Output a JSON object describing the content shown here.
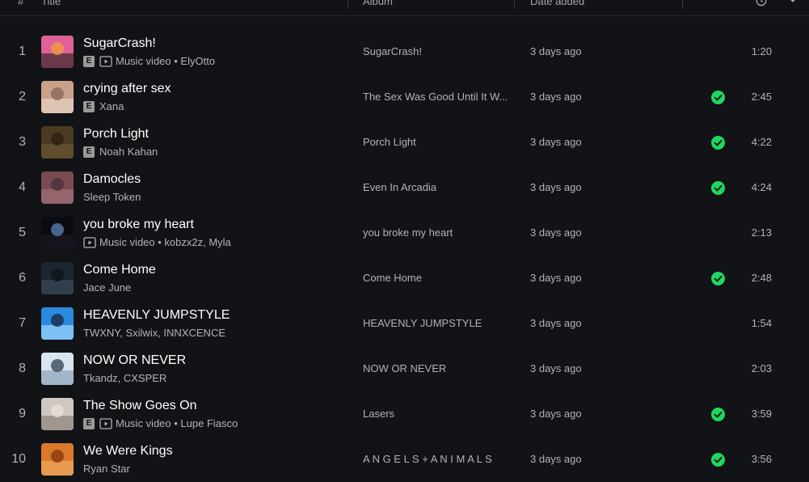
{
  "header": {
    "num": "#",
    "title": "Title",
    "album": "Album",
    "date_added": "Date added",
    "duration_icon": "clock-icon",
    "menu_icon": "chevron-down-icon"
  },
  "colors": {
    "background": "#121316",
    "saved_check": "#1ed760",
    "title_text": "#ffffff",
    "secondary_text": "#b3b3b3"
  },
  "tracks": [
    {
      "num": "1",
      "title": "SugarCrash!",
      "explicit": true,
      "music_video": true,
      "artists": "ElyOtto",
      "album": "SugarCrash!",
      "date": "3 days ago",
      "saved": false,
      "duration": "1:20"
    },
    {
      "num": "2",
      "title": "crying after sex",
      "explicit": true,
      "music_video": false,
      "artists": "Xana",
      "album": "The Sex Was Good Until It W...",
      "date": "3 days ago",
      "saved": true,
      "duration": "2:45"
    },
    {
      "num": "3",
      "title": "Porch Light",
      "explicit": true,
      "music_video": false,
      "artists": "Noah Kahan",
      "album": "Porch Light",
      "date": "3 days ago",
      "saved": true,
      "duration": "4:22"
    },
    {
      "num": "4",
      "title": "Damocles",
      "explicit": false,
      "music_video": false,
      "artists": "Sleep Token",
      "album": "Even In Arcadia",
      "date": "3 days ago",
      "saved": true,
      "duration": "4:24"
    },
    {
      "num": "5",
      "title": "you broke my heart",
      "explicit": false,
      "music_video": true,
      "artists": "kobzx2z, Myla",
      "album": "you broke my heart",
      "date": "3 days ago",
      "saved": false,
      "duration": "2:13"
    },
    {
      "num": "6",
      "title": "Come Home",
      "explicit": false,
      "music_video": false,
      "artists": "Jace June",
      "album": "Come Home",
      "date": "3 days ago",
      "saved": true,
      "duration": "2:48"
    },
    {
      "num": "7",
      "title": "HEAVENLY JUMPSTYLE",
      "explicit": false,
      "music_video": false,
      "artists": "TWXNY, Sxilwix, INNXCENCE",
      "album": "HEAVENLY JUMPSTYLE",
      "date": "3 days ago",
      "saved": false,
      "duration": "1:54"
    },
    {
      "num": "8",
      "title": "NOW OR NEVER",
      "explicit": false,
      "music_video": false,
      "artists": "Tkandz, CXSPER",
      "album": "NOW OR NEVER",
      "date": "3 days ago",
      "saved": false,
      "duration": "2:03"
    },
    {
      "num": "9",
      "title": "The Show Goes On",
      "explicit": true,
      "music_video": true,
      "artists": "Lupe Fiasco",
      "album": "Lasers",
      "date": "3 days ago",
      "saved": true,
      "duration": "3:59"
    },
    {
      "num": "10",
      "title": "We Were Kings",
      "explicit": false,
      "music_video": false,
      "artists": "Ryan Star",
      "album": "A N G E L S + A N I M A L S",
      "date": "3 days ago",
      "saved": true,
      "duration": "3:56"
    }
  ],
  "labels": {
    "explicit_badge": "E",
    "music_video_text": "Music video",
    "separator": " • "
  }
}
